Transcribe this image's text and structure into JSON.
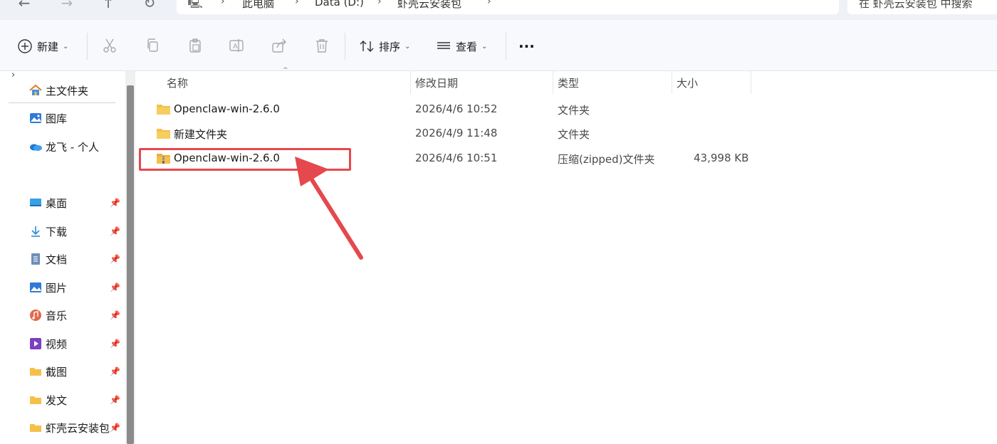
{
  "address_bar": {
    "breadcrumbs": [
      "此电脑",
      "Data (D:)",
      "虾壳云安装包"
    ],
    "search_placeholder": "在 虾壳云安装包 中搜索"
  },
  "toolbar": {
    "new_label": "新建",
    "sort_label": "排序",
    "view_label": "查看",
    "more_label": "···"
  },
  "sidebar": {
    "top_items": [
      {
        "label": "主文件夹",
        "icon": "home-icon"
      },
      {
        "label": "图库",
        "icon": "gallery-icon"
      },
      {
        "label": "龙飞 - 个人",
        "icon": "cloud-icon"
      }
    ],
    "pinned_items": [
      {
        "label": "桌面",
        "icon": "desktop-icon"
      },
      {
        "label": "下载",
        "icon": "download-icon"
      },
      {
        "label": "文档",
        "icon": "document-icon"
      },
      {
        "label": "图片",
        "icon": "pictures-icon"
      },
      {
        "label": "音乐",
        "icon": "music-icon"
      },
      {
        "label": "视频",
        "icon": "video-icon"
      },
      {
        "label": "截图",
        "icon": "folder-icon"
      },
      {
        "label": "发文",
        "icon": "folder-icon"
      },
      {
        "label": "虾壳云安装包",
        "icon": "folder-icon"
      }
    ]
  },
  "file_list": {
    "columns": [
      "名称",
      "修改日期",
      "类型",
      "大小"
    ],
    "rows": [
      {
        "name": "Openclaw-win-2.6.0",
        "date": "2026/4/6 10:52",
        "type": "文件夹",
        "size": "",
        "icon": "folder-icon"
      },
      {
        "name": "新建文件夹",
        "date": "2026/4/9 11:48",
        "type": "文件夹",
        "size": "",
        "icon": "folder-icon"
      },
      {
        "name": "Openclaw-win-2.6.0",
        "date": "2026/4/6 10:51",
        "type": "压缩(zipped)文件夹",
        "size": "43,998 KB",
        "icon": "zip-folder-icon"
      }
    ]
  },
  "colors": {
    "highlight": "#e5484d",
    "folder": "#f5c04a",
    "toolbar_bg": "#f7f9fc"
  }
}
